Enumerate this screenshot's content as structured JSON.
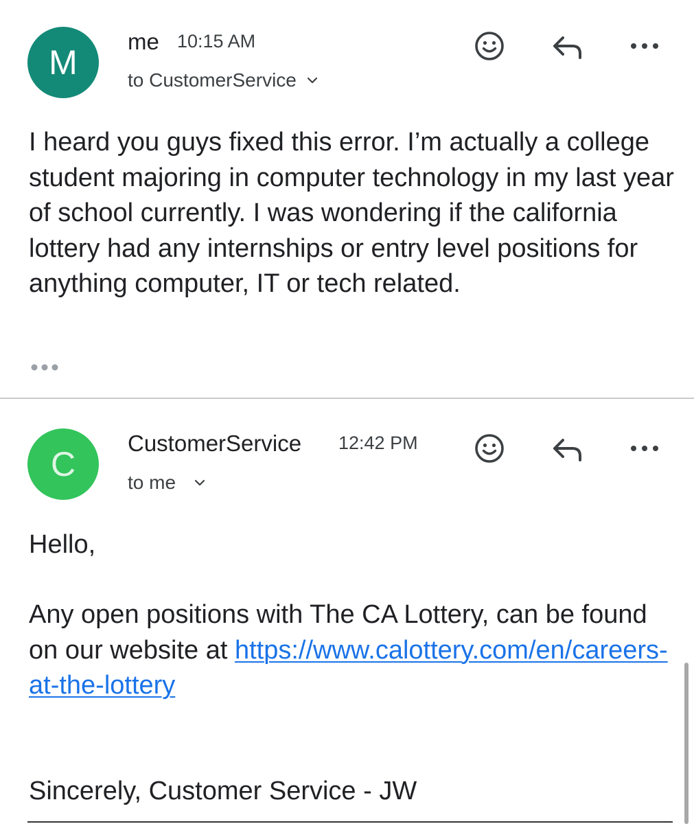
{
  "messages": [
    {
      "avatar_letter": "M",
      "avatar_color": "#138a77",
      "sender": "me",
      "time": "10:15 AM",
      "recipient": "to CustomerService",
      "body": "I heard you guys fixed this error. I’m actually a college student majoring in computer technology in my last year of school currently. I was wondering if the california lottery had any internships or entry level positions for anything computer, IT or tech related.",
      "actions": [
        "emoji-icon",
        "reply-icon",
        "more-icon"
      ]
    },
    {
      "avatar_letter": "C",
      "avatar_color": "#33c45b",
      "avatar_text_color": "#dff5e4",
      "sender": "CustomerService",
      "time": "12:42 PM",
      "recipient": "to me",
      "greeting": "Hello,",
      "paragraph": "Any open positions with The CA Lottery, can be found on our website at",
      "link": "https://www.calottery.com/en/careers-at-the-lottery",
      "signature": "Sincerely, Customer Service - JW",
      "actions": [
        "emoji-icon",
        "reply-icon",
        "more-icon"
      ]
    }
  ],
  "link_color": "#1a73e8"
}
